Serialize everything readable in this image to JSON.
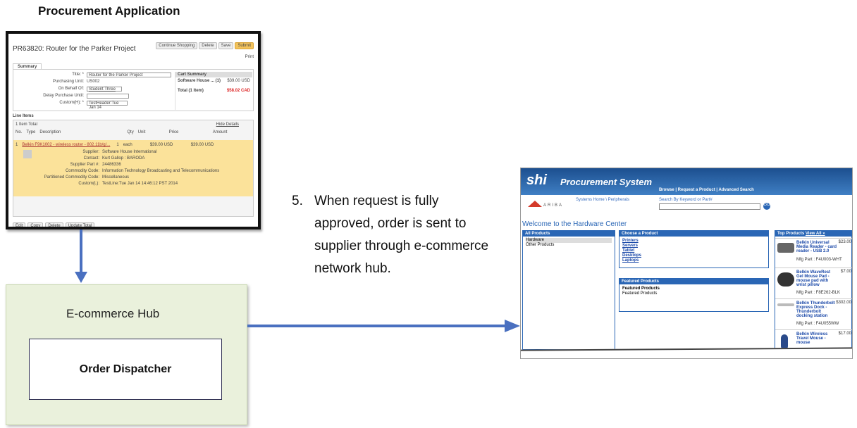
{
  "procurement": {
    "heading": "Procurement Application",
    "pr_title": "PR63820: Router for the Parker Project",
    "buttons": [
      "Continue Shopping",
      "Delete",
      "Save",
      "Submit"
    ],
    "print": "Print",
    "tab": "Summary",
    "fields": [
      {
        "label": "Title: *",
        "value": "Router for the Parker Project"
      },
      {
        "label": "Purchasing Unit:",
        "value": "US002"
      },
      {
        "label": "On Behalf Of:",
        "value": "Student Three"
      },
      {
        "label": "Delay Purchase Until:",
        "value": ""
      },
      {
        "label": "Custom(H): *",
        "value": "TestHeader:Tue Jan 14"
      }
    ],
    "cart": {
      "heading": "Cart Summary",
      "line": "Software House ... (1)",
      "line_amount": "$39.00 USD",
      "total_label": "Total (1 Item)",
      "total_amount": "$58.02 CAD"
    },
    "line_items_heading": "Line Items",
    "item_total": "1 Item Total",
    "hide_details": "Hide Details",
    "columns": [
      "No.",
      "Type",
      "Description",
      "Qty",
      "Unit",
      "Price",
      "Amount"
    ],
    "item": {
      "no": "1",
      "description": "Belkin F9K1002 - wireless router - 802.11b/g/...",
      "qty": "1",
      "unit": "each",
      "price": "$39.00 USD",
      "amount": "$39.00 USD"
    },
    "details": [
      {
        "label": "Supplier:",
        "value": "Software House International"
      },
      {
        "label": "Contact:",
        "value": "Kurt Gallop : BARODA"
      },
      {
        "label": "Supplier Part #:",
        "value": "24486336"
      },
      {
        "label": "Commodity Code:",
        "value": "Information Technology Broadcasting and Telecommunications"
      },
      {
        "label": "Partitioned Commodity Code:",
        "value": "Miscellaneous"
      },
      {
        "label": "Custom(L):",
        "value": "TestLine:Tue Jan 14 14:46:12 PST 2014"
      }
    ],
    "bottom_buttons": [
      "Edit",
      "Copy",
      "Delete",
      "Update Total"
    ]
  },
  "hub": {
    "label": "E-commerce Hub",
    "dispatcher": "Order Dispatcher"
  },
  "step": {
    "number": "5.",
    "text": "When request is fully approved, order is sent to supplier through e-commerce network hub."
  },
  "shi": {
    "logo": "shi",
    "system": "Procurement System",
    "nav": "Browse | Request a Product | Advanced Search",
    "ariba": "ARIBA",
    "crumbs": "Systems Home \\ Peripherals",
    "search_label": "Search By Keyword or Part#",
    "go": "GO",
    "welcome": "Welcome to the Hardware Center",
    "all_products": "All Products",
    "categories": [
      "Hardware",
      "Other Products"
    ],
    "choose_product": "Choose a Product",
    "product_links": [
      "Printers",
      "Servers",
      "Tablet",
      "Desktops",
      "Laptops"
    ],
    "featured_heading": "Featured Products",
    "featured_title": "Featured Products",
    "featured_text": "Featured Products",
    "top_products": "Top Products",
    "view_all": "View All »",
    "products": [
      {
        "name": "Belkin Universal Media Reader - card reader - USB 2.0",
        "part": "Mfg Part : F4U003-WHT",
        "price": "$23.00"
      },
      {
        "name": "Belkin WaveRest Gel Mouse Pad - mouse pad with wrist pillow",
        "part": "Mfg Part : F8E262-BLK",
        "price": "$7.00"
      },
      {
        "name": "Belkin Thunderbolt Express Dock - Thunderbolt docking station",
        "part": "Mfg Part : F4U055WW",
        "price": "$302.00"
      },
      {
        "name": "Belkin Wireless Travel Mouse - mouse",
        "part": "",
        "price": "$17.00"
      }
    ]
  }
}
